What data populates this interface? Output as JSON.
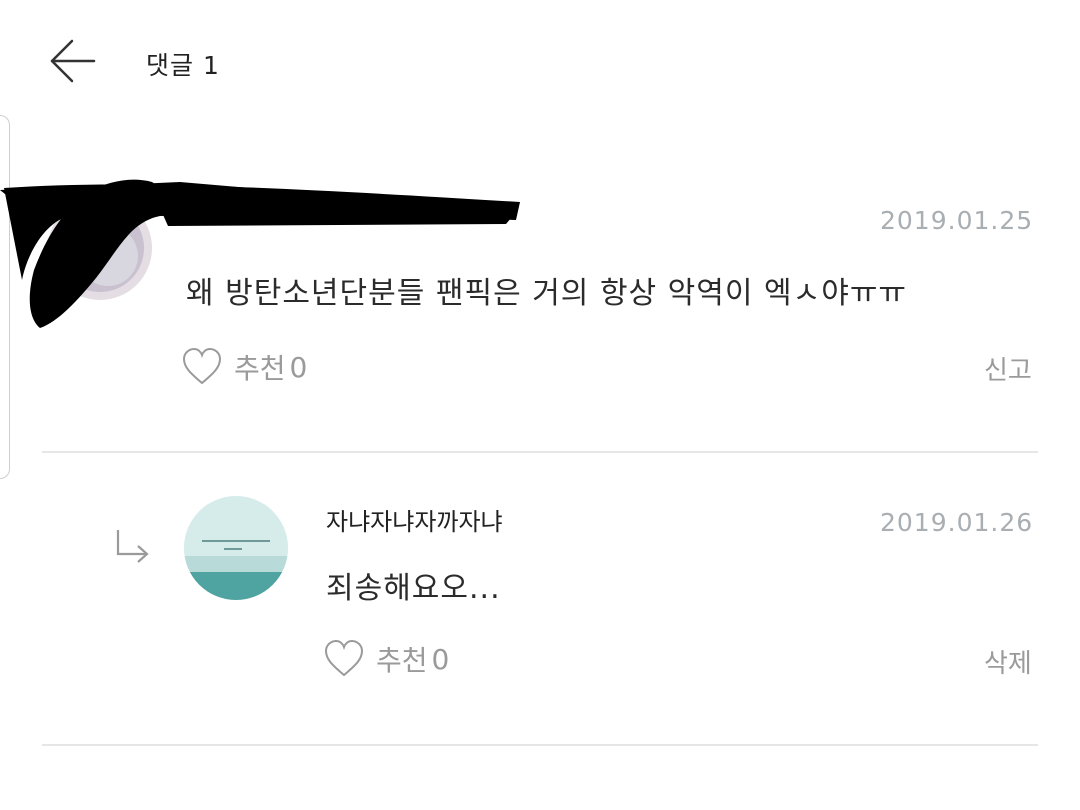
{
  "header": {
    "title": "댓글 1",
    "back_icon": "arrow-left-icon"
  },
  "comments": [
    {
      "author": "",
      "date": "2019.01.25",
      "text": "왜 방탄소년단분들 팬픽은 거의 항상 악역이 엑ㅅ야ㅠㅠ",
      "like_label": "추천",
      "like_count": "0",
      "action": "신고"
    }
  ],
  "replies": [
    {
      "author": "자냐자냐자까자냐",
      "date": "2019.01.26",
      "text": "죄송해요오...",
      "like_label": "추천",
      "like_count": "0",
      "action": "삭제",
      "reply_icon": "reply-arrow-icon"
    }
  ],
  "colors": {
    "date": "#a9aeb2",
    "divider": "#e6e6e6",
    "muted": "#9a9a9a"
  }
}
